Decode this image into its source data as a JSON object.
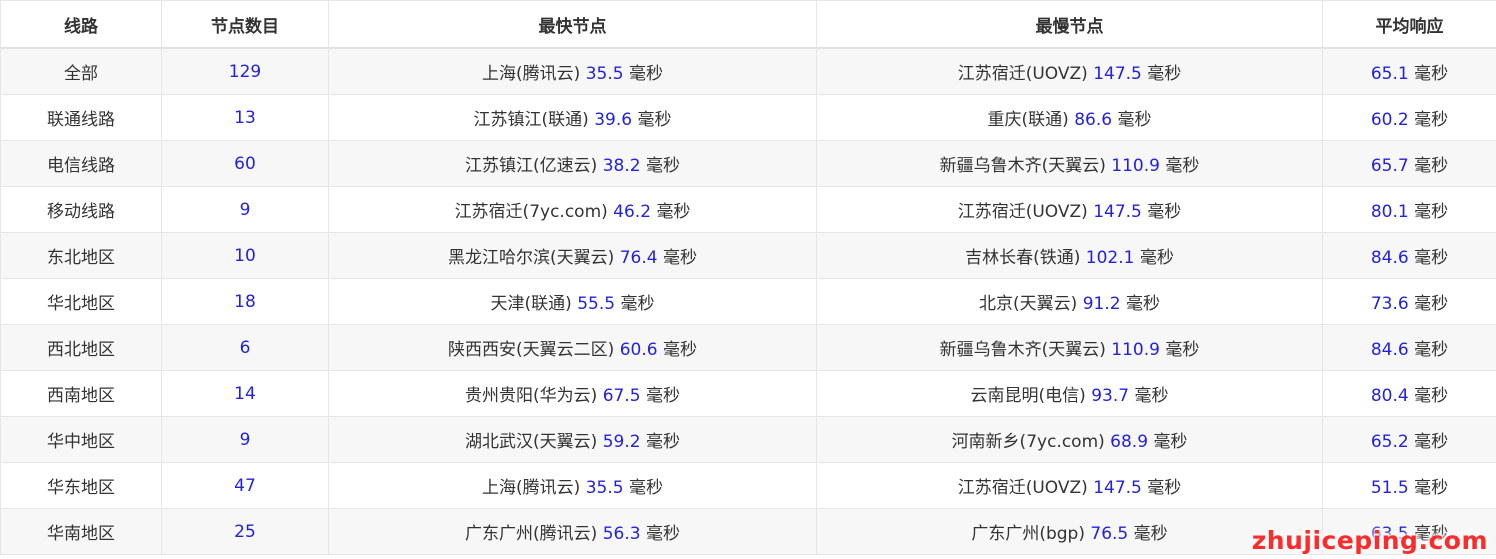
{
  "headers": [
    "线路",
    "节点数目",
    "最快节点",
    "最慢节点",
    "平均响应"
  ],
  "unit": "毫秒",
  "rows": [
    {
      "line": "全部",
      "count": "129",
      "fast_node": "上海(腾讯云)",
      "fast_ms": "35.5",
      "slow_node": "江苏宿迁(UOVZ)",
      "slow_ms": "147.5",
      "avg_ms": "65.1"
    },
    {
      "line": "联通线路",
      "count": "13",
      "fast_node": "江苏镇江(联通)",
      "fast_ms": "39.6",
      "slow_node": "重庆(联通)",
      "slow_ms": "86.6",
      "avg_ms": "60.2"
    },
    {
      "line": "电信线路",
      "count": "60",
      "fast_node": "江苏镇江(亿速云)",
      "fast_ms": "38.2",
      "slow_node": "新疆乌鲁木齐(天翼云)",
      "slow_ms": "110.9",
      "avg_ms": "65.7"
    },
    {
      "line": "移动线路",
      "count": "9",
      "fast_node": "江苏宿迁(7yc.com)",
      "fast_ms": "46.2",
      "slow_node": "江苏宿迁(UOVZ)",
      "slow_ms": "147.5",
      "avg_ms": "80.1"
    },
    {
      "line": "东北地区",
      "count": "10",
      "fast_node": "黑龙江哈尔滨(天翼云)",
      "fast_ms": "76.4",
      "slow_node": "吉林长春(铁通)",
      "slow_ms": "102.1",
      "avg_ms": "84.6"
    },
    {
      "line": "华北地区",
      "count": "18",
      "fast_node": "天津(联通)",
      "fast_ms": "55.5",
      "slow_node": "北京(天翼云)",
      "slow_ms": "91.2",
      "avg_ms": "73.6"
    },
    {
      "line": "西北地区",
      "count": "6",
      "fast_node": "陕西西安(天翼云二区)",
      "fast_ms": "60.6",
      "slow_node": "新疆乌鲁木齐(天翼云)",
      "slow_ms": "110.9",
      "avg_ms": "84.6"
    },
    {
      "line": "西南地区",
      "count": "14",
      "fast_node": "贵州贵阳(华为云)",
      "fast_ms": "67.5",
      "slow_node": "云南昆明(电信)",
      "slow_ms": "93.7",
      "avg_ms": "80.4"
    },
    {
      "line": "华中地区",
      "count": "9",
      "fast_node": "湖北武汉(天翼云)",
      "fast_ms": "59.2",
      "slow_node": "河南新乡(7yc.com)",
      "slow_ms": "68.9",
      "avg_ms": "65.2"
    },
    {
      "line": "华东地区",
      "count": "47",
      "fast_node": "上海(腾讯云)",
      "fast_ms": "35.5",
      "slow_node": "江苏宿迁(UOVZ)",
      "slow_ms": "147.5",
      "avg_ms": "51.5"
    },
    {
      "line": "华南地区",
      "count": "25",
      "fast_node": "广东广州(腾讯云)",
      "fast_ms": "56.3",
      "slow_node": "广东广州(bgp)",
      "slow_ms": "76.5",
      "avg_ms": "63.5"
    }
  ],
  "watermark": "zhujiceping.com",
  "colors": {
    "number": "#2222dd",
    "text": "#333333",
    "stripe": "#f7f7f7",
    "border": "#e6e6e6",
    "watermark": "#ff2a2a"
  }
}
